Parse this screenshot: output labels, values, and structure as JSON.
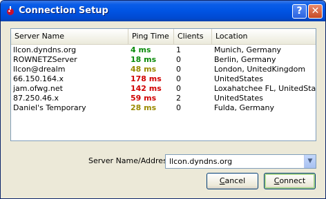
{
  "window": {
    "title": "Connection Setup",
    "help_label": "?",
    "close_label": "✕"
  },
  "table": {
    "columns": [
      {
        "label": "Server Name"
      },
      {
        "label": "Ping Time"
      },
      {
        "label": "Clients"
      },
      {
        "label": "Location"
      }
    ],
    "rows": [
      {
        "name": "llcon.dyndns.org",
        "ping": "4 ms",
        "ping_color": "#0a8a0a",
        "clients": "1",
        "location": "Munich, Germany"
      },
      {
        "name": "ROWNETZServer",
        "ping": "18 ms",
        "ping_color": "#0a8a0a",
        "clients": "0",
        "location": "Berlin, Germany"
      },
      {
        "name": "llcon@drealm",
        "ping": "48 ms",
        "ping_color": "#9a8a00",
        "clients": "0",
        "location": "London, UnitedKingdom"
      },
      {
        "name": "66.150.164.x",
        "ping": "178 ms",
        "ping_color": "#d00000",
        "clients": "0",
        "location": "UnitedStates"
      },
      {
        "name": "jam.ofwg.net",
        "ping": "142 ms",
        "ping_color": "#d00000",
        "clients": "0",
        "location": "Loxahatchee FL, UnitedStat..."
      },
      {
        "name": "87.250.46.x",
        "ping": "59 ms",
        "ping_color": "#d00000",
        "clients": "2",
        "location": "UnitedStates"
      },
      {
        "name": "Daniel's Temporary",
        "ping": "28 ms",
        "ping_color": "#9a8a00",
        "clients": "0",
        "location": "Fulda, Germany"
      }
    ]
  },
  "address": {
    "label": "Server Name/Address",
    "value": "llcon.dyndns.org"
  },
  "buttons": {
    "cancel_mnemonic": "C",
    "cancel_rest": "ancel",
    "connect_mnemonic": "C",
    "connect_rest": "onnect"
  }
}
